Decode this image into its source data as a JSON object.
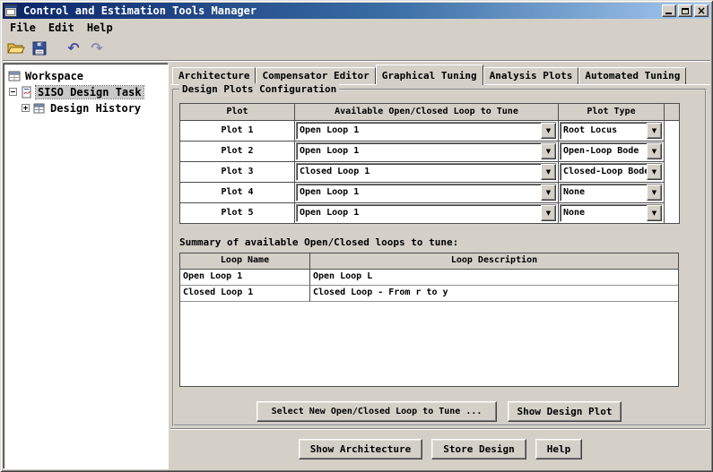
{
  "window": {
    "title": "Control and Estimation Tools Manager",
    "controls": {
      "close": "×"
    }
  },
  "icons": {
    "dropdown": "▼",
    "undo": "↶",
    "redo": "↷"
  },
  "menu": {
    "items": [
      "File",
      "Edit",
      "Help"
    ]
  },
  "tree": {
    "items": [
      {
        "label": "Workspace",
        "selected": false
      },
      {
        "label": "SISO Design Task",
        "selected": true
      },
      {
        "label": "Design History",
        "selected": false
      }
    ]
  },
  "tabs": [
    {
      "label": "Architecture",
      "active": false
    },
    {
      "label": "Compensator Editor",
      "active": false
    },
    {
      "label": "Graphical Tuning",
      "active": true
    },
    {
      "label": "Analysis Plots",
      "active": false
    },
    {
      "label": "Automated Tuning",
      "active": false
    }
  ],
  "design_plots": {
    "group_title": "Design Plots Configuration",
    "table": {
      "headers": [
        "Plot",
        "Available Open/Closed Loop to Tune",
        "Plot Type"
      ],
      "rows": [
        {
          "plot": "Plot 1",
          "loop": "Open Loop 1",
          "type": "Root Locus"
        },
        {
          "plot": "Plot 2",
          "loop": "Open Loop 1",
          "type": "Open-Loop Bode"
        },
        {
          "plot": "Plot 3",
          "loop": "Closed Loop 1",
          "type": "Closed-Loop Bode"
        },
        {
          "plot": "Plot 4",
          "loop": "Open Loop 1",
          "type": "None"
        },
        {
          "plot": "Plot 5",
          "loop": "Open Loop 1",
          "type": "None"
        }
      ]
    },
    "summary_label": "Summary of available Open/Closed loops to tune:",
    "summary_table": {
      "headers": [
        "Loop Name",
        "Loop Description"
      ],
      "rows": [
        {
          "name": "Open Loop 1",
          "description": "Open Loop L"
        },
        {
          "name": "Closed Loop 1",
          "description": "Closed Loop - From r to y"
        }
      ]
    },
    "buttons": {
      "select_new": "Select New Open/Closed Loop to Tune ...",
      "show_design_plot": "Show Design Plot"
    }
  },
  "footer": {
    "buttons": [
      "Show Architecture",
      "Store Design",
      "Help"
    ]
  },
  "colors": {
    "titlebar_gradient_start": "#0a246a",
    "titlebar_gradient_end": "#a6caf0",
    "chrome": "#d4d0c8",
    "table_line": "#4d4d4d",
    "selection_bg": "#c8c8c8"
  }
}
